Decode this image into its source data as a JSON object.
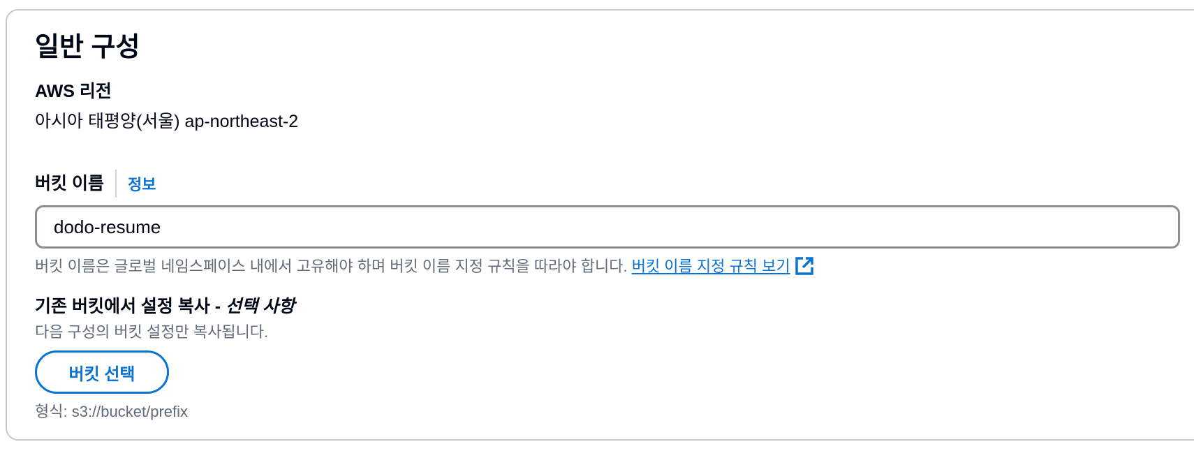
{
  "panel": {
    "title": "일반 구성"
  },
  "region": {
    "label": "AWS 리전",
    "value": "아시아 태평양(서울) ap-northeast-2"
  },
  "bucket_name": {
    "label": "버킷 이름",
    "info_link": "정보",
    "value": "dodo-resume",
    "hint": "버킷 이름은 글로벌 네임스페이스 내에서 고유해야 하며 버킷 이름 지정 규칙을 따라야 합니다.",
    "rules_link": "버킷 이름 지정 규칙 보기",
    "rules_link_icon": "external-link-icon"
  },
  "copy_settings": {
    "label": "기존 버킷에서 설정 복사 -",
    "optional": "선택 사항",
    "description": "다음 구성의 버킷 설정만 복사됩니다.",
    "button_label": "버킷 선택",
    "format": "형식: s3://bucket/prefix"
  },
  "colors": {
    "link": "#0972d3",
    "text": "#000716",
    "secondary_text": "#5f6b7a",
    "border": "#c6c6cd"
  }
}
